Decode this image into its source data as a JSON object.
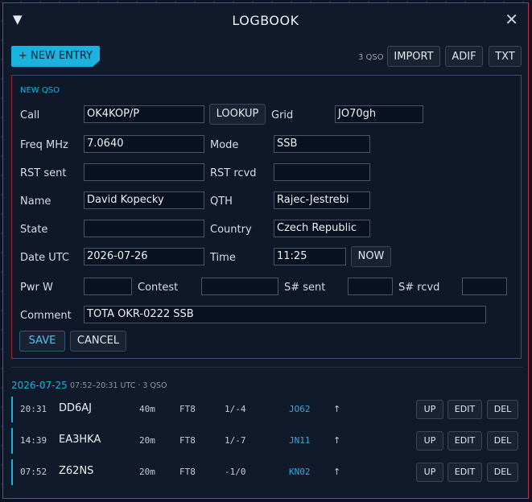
{
  "window": {
    "title": "LOGBOOK",
    "collapse_icon": "▼",
    "close_icon": "✕"
  },
  "toolbar": {
    "new_entry": "+ NEW ENTRY",
    "qso_count": "3 QSO",
    "import": "IMPORT",
    "adif": "ADIF",
    "txt": "TXT"
  },
  "form": {
    "title": "NEW QSO",
    "call": {
      "label": "Call",
      "value": "OK4KOP/P"
    },
    "lookup": "LOOKUP",
    "grid": {
      "label": "Grid",
      "value": "JO70gh"
    },
    "freq": {
      "label": "Freq MHz",
      "value": "7.0640"
    },
    "mode": {
      "label": "Mode",
      "value": "SSB"
    },
    "rst_sent": {
      "label": "RST sent",
      "value": ""
    },
    "rst_rcvd": {
      "label": "RST rcvd",
      "value": ""
    },
    "name": {
      "label": "Name",
      "value": "David Kopecky"
    },
    "qth": {
      "label": "QTH",
      "value": "Rajec-Jestrebi"
    },
    "state": {
      "label": "State",
      "value": ""
    },
    "country": {
      "label": "Country",
      "value": "Czech Republic"
    },
    "date": {
      "label": "Date UTC",
      "value": "2026-07-26"
    },
    "time": {
      "label": "Time",
      "value": "11:25"
    },
    "now": "NOW",
    "pwr": {
      "label": "Pwr W",
      "value": ""
    },
    "contest": {
      "label": "Contest",
      "value": ""
    },
    "s_sent": {
      "label": "S# sent",
      "value": ""
    },
    "s_rcvd": {
      "label": "S# rcvd",
      "value": ""
    },
    "comment": {
      "label": "Comment",
      "value": "TOTA OKR-0222 SSB"
    },
    "save": "SAVE",
    "cancel": "CANCEL"
  },
  "log": {
    "date": "2026-07-25",
    "summary": "07:52–20:31 UTC · 3 QSO",
    "buttons": {
      "up": "UP",
      "edit": "EDIT",
      "del": "DEL"
    },
    "rows": [
      {
        "time": "20:31",
        "call": "DD6AJ",
        "band": "40m",
        "mode": "FT8",
        "rst": "1/-4",
        "grid": "JO62",
        "arrow": "↑"
      },
      {
        "time": "14:39",
        "call": "EA3HKA",
        "band": "20m",
        "mode": "FT8",
        "rst": "1/-7",
        "grid": "JN11",
        "arrow": "↑"
      },
      {
        "time": "07:52",
        "call": "Z62NS",
        "band": "20m",
        "mode": "FT8",
        "rst": "-1/0",
        "grid": "KN02",
        "arrow": "↑"
      }
    ]
  },
  "colors": {
    "accent": "#1ab3e0",
    "border": "#b8324a",
    "panel": "#111a2b"
  }
}
